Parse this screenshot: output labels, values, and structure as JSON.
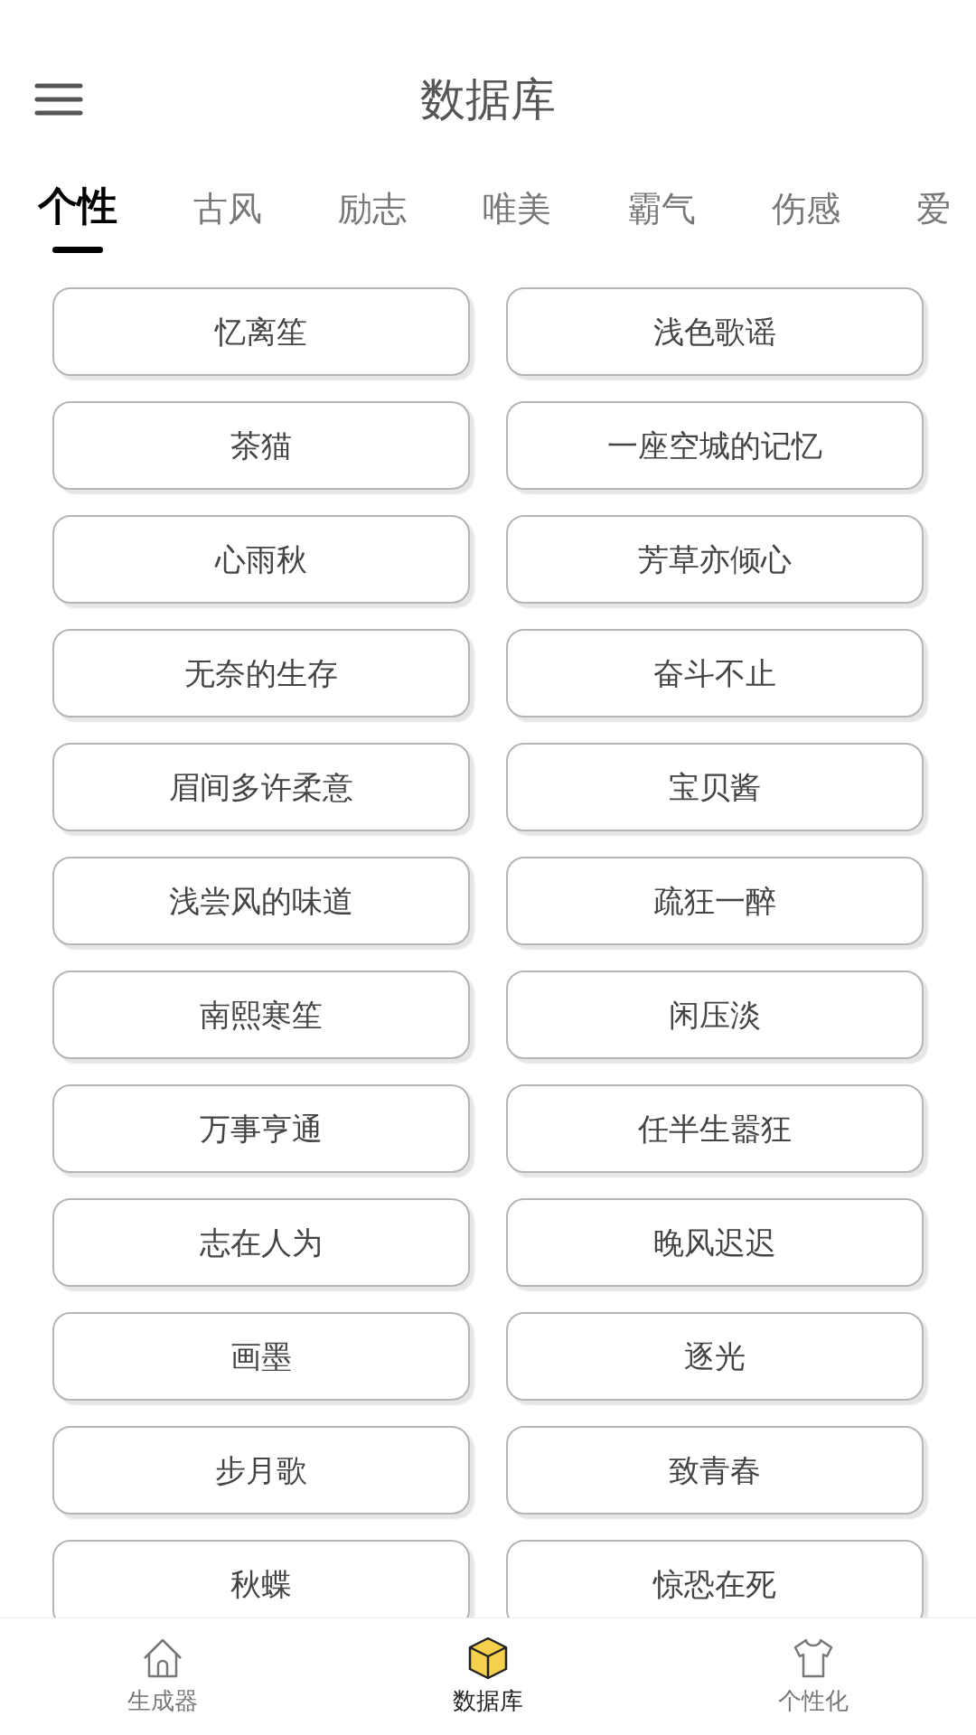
{
  "header": {
    "title": "数据库"
  },
  "tabs": [
    {
      "label": "个性",
      "selected": true
    },
    {
      "label": "古风",
      "selected": false
    },
    {
      "label": "励志",
      "selected": false
    },
    {
      "label": "唯美",
      "selected": false
    },
    {
      "label": "霸气",
      "selected": false
    },
    {
      "label": "伤感",
      "selected": false
    },
    {
      "label": "爱",
      "selected": false
    }
  ],
  "names": [
    "忆离笙",
    "浅色歌谣",
    "茶猫",
    "一座空城的记忆",
    "心雨秋",
    "芳草亦倾心",
    "无奈的生存",
    "奋斗不止",
    "眉间多许柔意",
    "宝贝酱",
    "浅尝风的味道",
    "疏狂一醉",
    "南熙寒笙",
    "闲压淡",
    "万事亨通",
    "任半生嚣狂",
    "志在人为",
    "晚风迟迟",
    "画墨",
    "逐光",
    "步月歌",
    "致青春",
    "秋蝶",
    "惊恐在死"
  ],
  "bottom_nav": [
    {
      "label": "生成器",
      "kind": "home",
      "selected": false
    },
    {
      "label": "数据库",
      "kind": "box",
      "selected": true
    },
    {
      "label": "个性化",
      "kind": "shirt",
      "selected": false
    }
  ]
}
